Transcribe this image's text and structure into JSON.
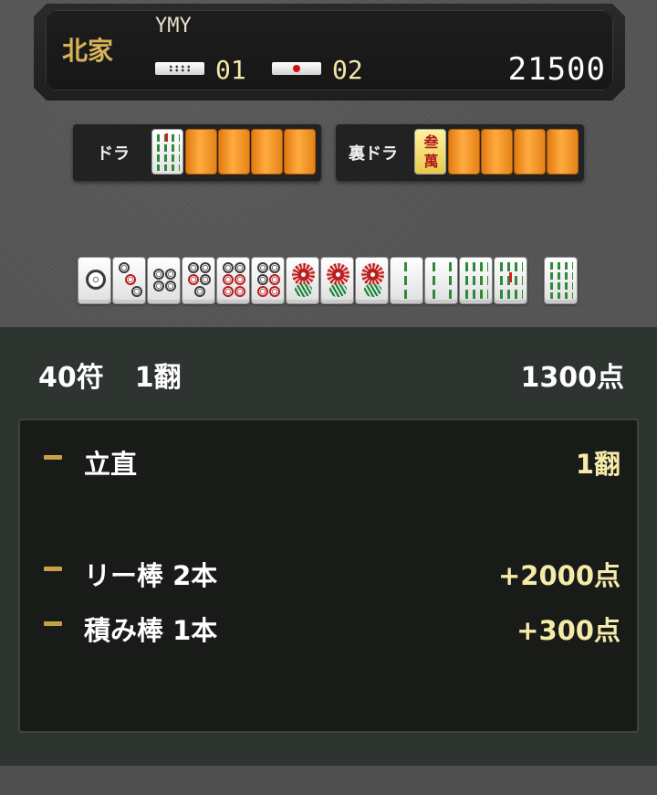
{
  "player": {
    "seat_wind": "北家",
    "name": "YMY",
    "hundred_stick_count": "01",
    "thousand_stick_count": "02",
    "score": "21500"
  },
  "dora": {
    "label": "ドラ",
    "indicator_tile": "8-sou",
    "hidden_count": 4
  },
  "ura_dora": {
    "label": "裏ドラ",
    "indicator_tile": "3-man",
    "indicator_text": "叁萬",
    "hidden_count": 4
  },
  "hand": {
    "tiles": [
      "1-pin",
      "3-pin",
      "4-pin",
      "5-pin",
      "6-pin",
      "7-pin",
      "1-sou",
      "1-sou",
      "1-sou",
      "2-sou",
      "4-sou",
      "6-sou",
      "7-sou"
    ],
    "winning_tile": "9-sou"
  },
  "result": {
    "fu_label": "40符",
    "han_label": "1翻",
    "total": "1300点"
  },
  "yaku": [
    {
      "name": "立直",
      "value": "1翻"
    },
    {
      "name": "",
      "value": ""
    },
    {
      "name": "リー棒 2本",
      "value": "+2000点"
    },
    {
      "name": "積み棒 1本",
      "value": "+300点"
    }
  ],
  "colors": {
    "gold_text": "#d8b25a",
    "value_text": "#f5eba9",
    "hidden_tile": "#ffab40"
  }
}
